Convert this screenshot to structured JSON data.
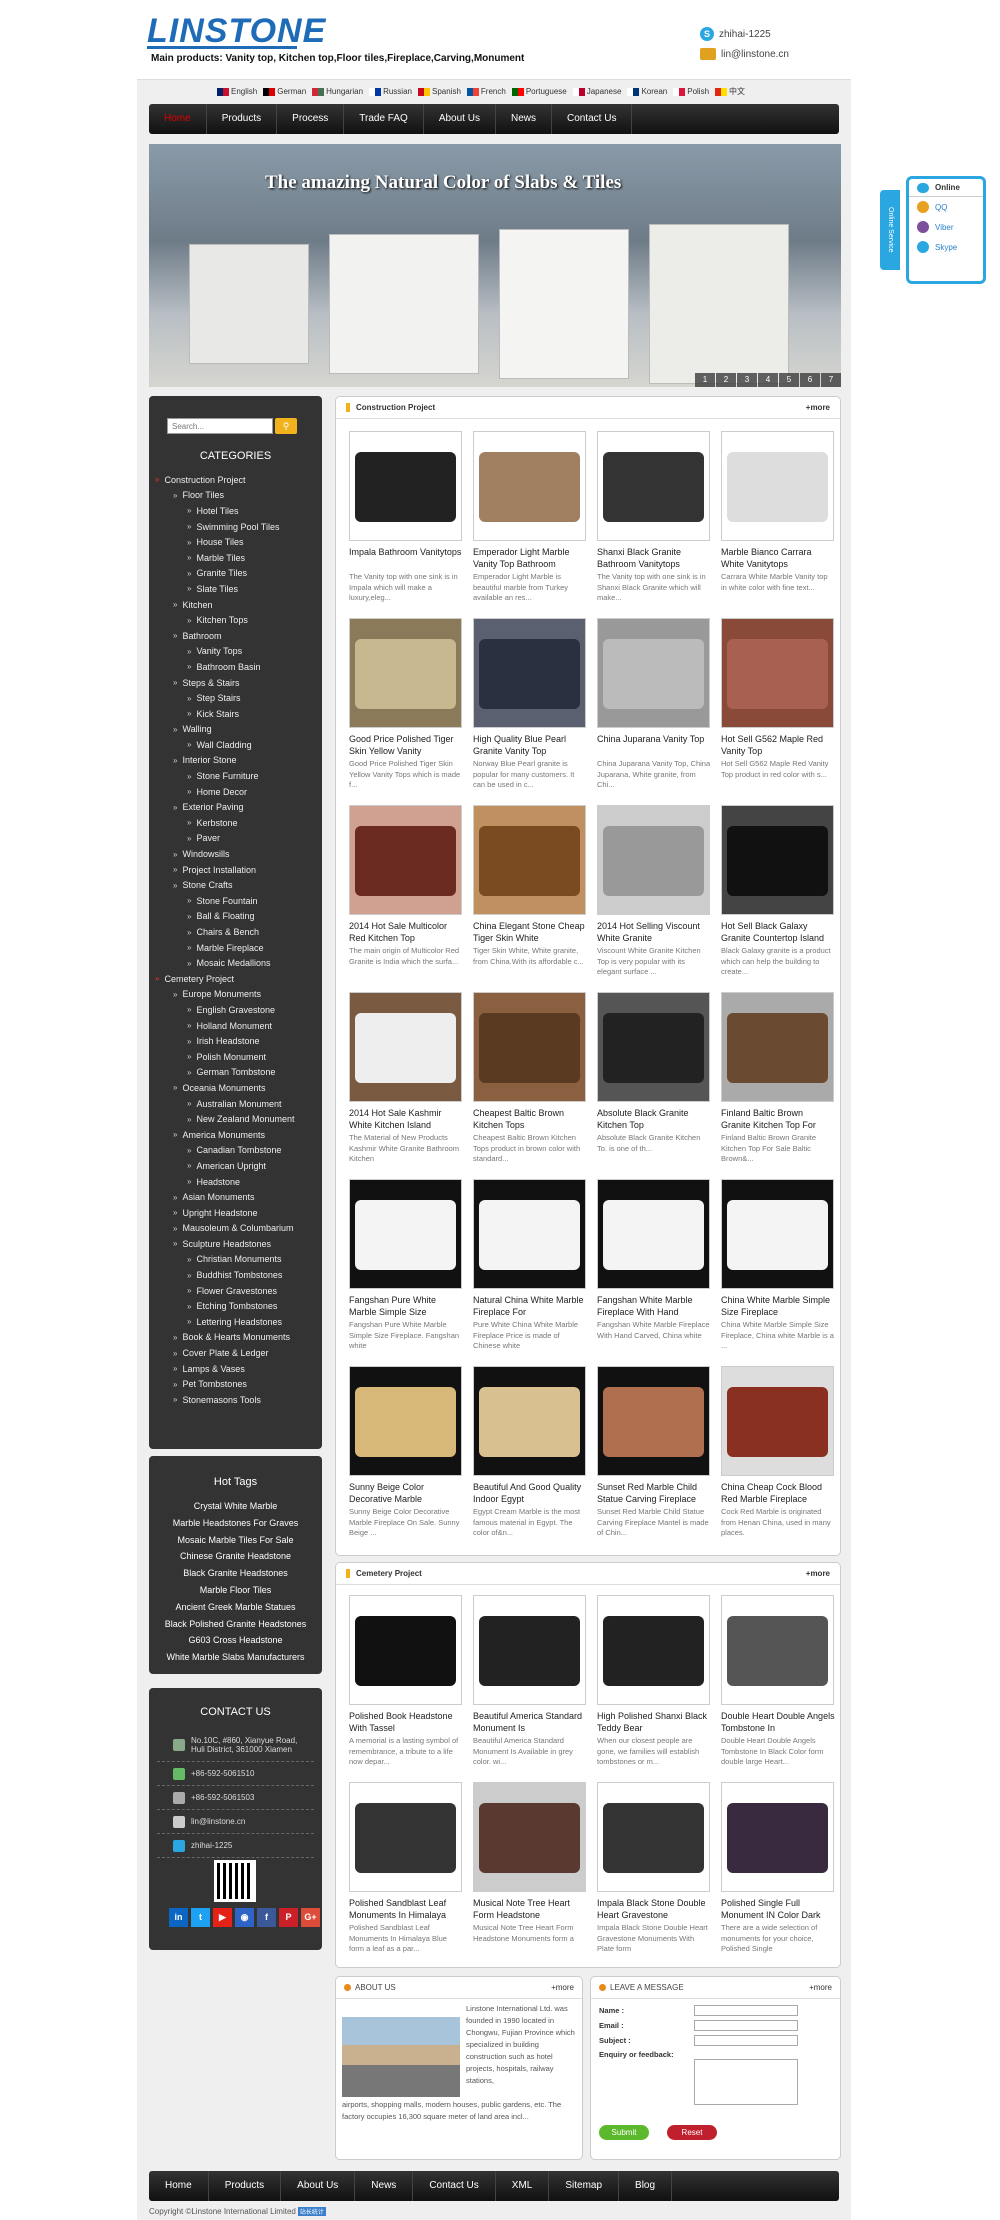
{
  "header": {
    "logo": "LINSTONE",
    "main_products": "Main products: Vanity top, Kitchen top,Floor tiles,Fireplace,Carving,Monument",
    "skype": "zhihai-1225",
    "email": "lin@linstone.cn"
  },
  "languages": [
    {
      "name": "English",
      "colors": [
        "#012169",
        "#c8102e"
      ]
    },
    {
      "name": "German",
      "colors": [
        "#000",
        "#dd0000"
      ]
    },
    {
      "name": "Hungarian",
      "colors": [
        "#ce2939",
        "#477050"
      ]
    },
    {
      "name": "Russian",
      "colors": [
        "#fff",
        "#0039a6"
      ]
    },
    {
      "name": "Spanish",
      "colors": [
        "#c60b1e",
        "#ffc400"
      ]
    },
    {
      "name": "French",
      "colors": [
        "#0055a4",
        "#ef4135"
      ]
    },
    {
      "name": "Portuguese",
      "colors": [
        "#006600",
        "#ff0000"
      ]
    },
    {
      "name": "Japanese",
      "colors": [
        "#fff",
        "#bc002d"
      ]
    },
    {
      "name": "Korean",
      "colors": [
        "#fff",
        "#003478"
      ]
    },
    {
      "name": "Polish",
      "colors": [
        "#fff",
        "#dc143c"
      ]
    },
    {
      "name": "中文",
      "colors": [
        "#de2910",
        "#ffde00"
      ]
    }
  ],
  "nav": [
    "Home",
    "Products",
    "Process",
    "Trade FAQ",
    "About Us",
    "News",
    "Contact Us"
  ],
  "banner": {
    "headline": "The amazing Natural Color of Slabs & Tiles",
    "pages": [
      "1",
      "2",
      "3",
      "4",
      "5",
      "6",
      "7"
    ]
  },
  "sidebar": {
    "search_placeholder": "Search...",
    "categories_title": "CATEGORIES",
    "categories": [
      {
        "label": "Construction Project",
        "level": 0
      },
      {
        "label": "Floor Tiles",
        "level": 1
      },
      {
        "label": "Hotel Tiles",
        "level": 2
      },
      {
        "label": "Swimming Pool Tiles",
        "level": 2
      },
      {
        "label": "House Tiles",
        "level": 2
      },
      {
        "label": "Marble Tiles",
        "level": 2
      },
      {
        "label": "Granite Tiles",
        "level": 2
      },
      {
        "label": "Slate Tiles",
        "level": 2
      },
      {
        "label": "Kitchen",
        "level": 1
      },
      {
        "label": "Kitchen Tops",
        "level": 2
      },
      {
        "label": "Bathroom",
        "level": 1
      },
      {
        "label": "Vanity Tops",
        "level": 2
      },
      {
        "label": "Bathroom Basin",
        "level": 2
      },
      {
        "label": "Steps & Stairs",
        "level": 1
      },
      {
        "label": "Step Stairs",
        "level": 2
      },
      {
        "label": "Kick Stairs",
        "level": 2
      },
      {
        "label": "Walling",
        "level": 1
      },
      {
        "label": "Wall Cladding",
        "level": 2
      },
      {
        "label": "Interior Stone",
        "level": 1
      },
      {
        "label": "Stone Furniture",
        "level": 2
      },
      {
        "label": "Home Decor",
        "level": 2
      },
      {
        "label": "Exterior Paving",
        "level": 1
      },
      {
        "label": "Kerbstone",
        "level": 2
      },
      {
        "label": "Paver",
        "level": 2
      },
      {
        "label": "Windowsills",
        "level": 1
      },
      {
        "label": "Project Installation",
        "level": 1
      },
      {
        "label": "Stone Crafts",
        "level": 1
      },
      {
        "label": "Stone Fountain",
        "level": 2
      },
      {
        "label": "Ball & Floating",
        "level": 2
      },
      {
        "label": "Chairs & Bench",
        "level": 2
      },
      {
        "label": "Marble Fireplace",
        "level": 2
      },
      {
        "label": "Mosaic Medallions",
        "level": 2
      },
      {
        "label": "Cemetery Project",
        "level": 0
      },
      {
        "label": "Europe Monuments",
        "level": 1
      },
      {
        "label": "English Gravestone",
        "level": 2
      },
      {
        "label": "Holland Monument",
        "level": 2
      },
      {
        "label": "Irish Headstone",
        "level": 2
      },
      {
        "label": "Polish Monument",
        "level": 2
      },
      {
        "label": "German Tombstone",
        "level": 2
      },
      {
        "label": "Oceania Monuments",
        "level": 1
      },
      {
        "label": "Australian Monument",
        "level": 2
      },
      {
        "label": "New Zealand Monument",
        "level": 2
      },
      {
        "label": "America Monuments",
        "level": 1
      },
      {
        "label": "Canadian Tombstone",
        "level": 2
      },
      {
        "label": "American Upright",
        "level": 2
      },
      {
        "label": "Headstone",
        "level": 2
      },
      {
        "label": "Asian Monuments",
        "level": 1
      },
      {
        "label": "Upright Headstone",
        "level": 1
      },
      {
        "label": "Mausoleum & Columbarium",
        "level": 1
      },
      {
        "label": "Sculpture Headstones",
        "level": 1
      },
      {
        "label": "Christian Monuments",
        "level": 2
      },
      {
        "label": "Buddhist Tombstones",
        "level": 2
      },
      {
        "label": "Flower Gravestones",
        "level": 2
      },
      {
        "label": "Etching Tombstones",
        "level": 2
      },
      {
        "label": "Lettering Headstones",
        "level": 2
      },
      {
        "label": "Book & Hearts Monuments",
        "level": 1
      },
      {
        "label": "Cover Plate & Ledger",
        "level": 1
      },
      {
        "label": "Lamps & Vases",
        "level": 1
      },
      {
        "label": "Pet Tombstones",
        "level": 1
      },
      {
        "label": "Stonemasons Tools",
        "level": 1
      }
    ],
    "hot_tags_title": "Hot Tags",
    "hot_tags": [
      "Crystal White Marble",
      "Marble Headstones For Graves",
      "Mosaic Marble Tiles For Sale",
      "Chinese Granite Headstone",
      "Black Granite Headstones",
      "Marble Floor Tiles",
      "Ancient Greek Marble Statues",
      "Black Polished Granite Headstones",
      "G603 Cross Headstone",
      "White Marble Slabs Manufacturers"
    ],
    "contact_title": "CONTACT US",
    "contact": {
      "address": "No.10C, #860, Xianyue Road, Huli District, 361000 Xiamen",
      "phone": "+86-592-5061510",
      "fax": "+86-592-5061503",
      "email": "lin@linstone.cn",
      "skype": "zhihai-1225"
    },
    "social": [
      {
        "label": "in",
        "color": "#0a66c2"
      },
      {
        "label": "t",
        "color": "#1da1f2"
      },
      {
        "label": "▶",
        "color": "#e62117"
      },
      {
        "label": "◉",
        "color": "#2d64c5"
      },
      {
        "label": "f",
        "color": "#3b5998"
      },
      {
        "label": "P",
        "color": "#cb2027"
      },
      {
        "label": "G+",
        "color": "#dd4b39"
      }
    ]
  },
  "construction": {
    "title": "Construction Project",
    "more": "+more",
    "items": [
      {
        "name": "Impala Bathroom Vanitytops",
        "desc": "The Vanity top with one sink is in Impala which will make a luxury,eleg...",
        "bg": "#fff",
        "fg": "#222"
      },
      {
        "name": "Emperador Light Marble Vanity Top Bathroom",
        "desc": "Emperador Light Marble is beautiful marble from Turkey available an res...",
        "bg": "#fff",
        "fg": "#a08060"
      },
      {
        "name": "Shanxi Black Granite Bathroom Vanitytops",
        "desc": "The Vanity top with one sink is in Shanxi Black Granite which will make...",
        "bg": "#fff",
        "fg": "#333"
      },
      {
        "name": "Marble Bianco Carrara White Vanitytops",
        "desc": "Carrara White Marble Vanity top in white color with fine text...",
        "bg": "#fff",
        "fg": "#ddd"
      },
      {
        "name": "Good Price Polished Tiger Skin Yellow Vanity",
        "desc": "Good Price Polished Tiger Skin Yellow Vanity Tops which is made f...",
        "bg": "#8a7a5a",
        "fg": "#c8b890"
      },
      {
        "name": "High Quality Blue Pearl Granite Vanity Top",
        "desc": "Norway Blue Pearl granite is popular for many customers. It can be used in c...",
        "bg": "#5a6070",
        "fg": "#2a3040"
      },
      {
        "name": "China Juparana Vanity Top",
        "desc": "China Juparana Vanity Top, China Juparana, White granite, from Chi...",
        "bg": "#999",
        "fg": "#bbb"
      },
      {
        "name": "Hot Sell G562 Maple Red Vanity Top",
        "desc": "Hot Sell G562 Maple Red Vanity Top product in red color with s...",
        "bg": "#8a4a3a",
        "fg": "#a86050"
      },
      {
        "name": "2014 Hot Sale Multicolor Red Kitchen Top",
        "desc": "The main origin of Multicolor Red Granite is India which the surfa...",
        "bg": "#d0a090",
        "fg": "#6a2a20"
      },
      {
        "name": "China Elegant Stone Cheap Tiger Skin White",
        "desc": "Tiger Skin White, White granite, from China.With its affordable c...",
        "bg": "#c09060",
        "fg": "#7a4a20"
      },
      {
        "name": "2014 Hot Selling Viscount White Granite",
        "desc": "Viscount White Granite Kitchen Top is very popular with its elegant surface ...",
        "bg": "#ccc",
        "fg": "#999"
      },
      {
        "name": "Hot Sell Black Galaxy Granite Countertop Island",
        "desc": "Black Galaxy granite is a product which can help the building to create...",
        "bg": "#444",
        "fg": "#111"
      },
      {
        "name": "2014 Hot Sale Kashmir White Kitchen Island",
        "desc": "The Material of New Products Kashmir White Granite Bathroom Kitchen",
        "bg": "#7a5a40",
        "fg": "#eee"
      },
      {
        "name": "Cheapest Baltic Brown Kitchen Tops",
        "desc": "Cheapest Baltic Brown Kitchen Tops product in brown color with standard...",
        "bg": "#8a6040",
        "fg": "#5a3a20"
      },
      {
        "name": "Absolute Black Granite Kitchen Top",
        "desc": "Absolute Black Granite Kitchen To. is one of th...",
        "bg": "#555",
        "fg": "#222"
      },
      {
        "name": "Finland Baltic Brown Granite Kitchen Top For",
        "desc": "Finland Baltic Brown Granite Kitchen Top For Sale Baltic Brown&...",
        "bg": "#aaa",
        "fg": "#6a4a30"
      },
      {
        "name": "Fangshan Pure White Marble Simple Size",
        "desc": "Fangshan Pure White Marble Simple Size Fireplace. Fangshan white",
        "bg": "#111",
        "fg": "#f4f4f4"
      },
      {
        "name": "Natural China White Marble Fireplace For",
        "desc": "Pure White China White Marble Fireplace Price is made of Chinese white",
        "bg": "#111",
        "fg": "#f4f4f4"
      },
      {
        "name": "Fangshan White Marble Fireplace With Hand",
        "desc": "Fangshan White Marble Fireplace With Hand Carved, China white",
        "bg": "#111",
        "fg": "#f4f4f4"
      },
      {
        "name": "China White Marble Simple Size Fireplace",
        "desc": "China White Marble Simple Size Fireplace, China white Marble is a ...",
        "bg": "#111",
        "fg": "#f4f4f4"
      },
      {
        "name": "Sunny Beige Color Decorative Marble",
        "desc": "Sunny Beige Color Decorative Marble Fireplace On Sale. Sunny Beige ...",
        "bg": "#111",
        "fg": "#d8b878"
      },
      {
        "name": "Beautiful And Good Quality Indoor Egypt",
        "desc": "Egypt Cream Marble is the most famous material in Egypt. The color of&n...",
        "bg": "#111",
        "fg": "#d8c090"
      },
      {
        "name": "Sunset Red Marble Child Statue Carving Fireplace",
        "desc": "Sunset Red Marble Child Statue Carving Fireplace Mantel is made of Chin...",
        "bg": "#111",
        "fg": "#b07050"
      },
      {
        "name": "China Cheap Cock Blood Red Marble Fireplace",
        "desc": "Cock Red Marble is originated from Henan China, used in many places.",
        "bg": "#ddd",
        "fg": "#8a3020"
      }
    ]
  },
  "cemetery": {
    "title": "Cemetery Project",
    "more": "+more",
    "items": [
      {
        "name": "Polished Book Headstone With Tassel",
        "desc": "A memorial is a lasting symbol of remembrance, a tribute to a life now depar...",
        "bg": "#fff",
        "fg": "#111"
      },
      {
        "name": "Beautiful America Standard Monument Is",
        "desc": "Beautiful America Standard Monument Is Available in grey color. wi...",
        "bg": "#fff",
        "fg": "#222"
      },
      {
        "name": "High Polished Shanxi Black Teddy Bear",
        "desc": "When our closest people are gone, we families will establish tombstones or m...",
        "bg": "#fff",
        "fg": "#222"
      },
      {
        "name": "Double Heart Double Angels Tombstone In",
        "desc": "Double Heart Double Angels Tombstone In Black Color form double large Heart...",
        "bg": "#fff",
        "fg": "#555"
      },
      {
        "name": "Polished Sandblast Leaf Monuments In Himalaya",
        "desc": "Polished Sandblast Leaf Monuments In Himalaya Blue form a leaf as a par...",
        "bg": "#fff",
        "fg": "#333"
      },
      {
        "name": "Musical Note Tree Heart Form Headstone",
        "desc": "Musical Note Tree Heart Form Headstone Monuments form a",
        "bg": "#ccc",
        "fg": "#5a3a30"
      },
      {
        "name": "Impala Black Stone Double Heart Gravestone",
        "desc": "Impala Black Stone Double Heart Gravestone Monuments With Plate form",
        "bg": "#fff",
        "fg": "#333"
      },
      {
        "name": "Polished Single Full Monument IN Color Dark",
        "desc": "There are a wide selection of monuments for your choice, Polished Single",
        "bg": "#fff",
        "fg": "#3a2a40"
      }
    ]
  },
  "about": {
    "title": "ABOUT US",
    "more": "+more",
    "text1": "Linstone International Ltd. was founded in 1990 located in Chongwu, Fujian Province which specialized in building construction such as hotel projects, hospitals, railway stations,",
    "text2": "airports, shopping malls, modern houses, public gardens, etc. The factory occupies 16,300 square meter of land area incl..."
  },
  "message": {
    "title": "LEAVE A MESSAGE",
    "more": "+more",
    "name_label": "Name :",
    "email_label": "Email :",
    "subject_label": "Subject :",
    "enquiry_label": "Enquiry or feedback:",
    "submit": "Submit",
    "reset": "Reset"
  },
  "footer_nav": [
    "Home",
    "Products",
    "About Us",
    "News",
    "Contact Us",
    "XML",
    "Sitemap",
    "Blog"
  ],
  "copyright": "Copyright ©Linstone International Limited",
  "copyright_badge": "站长统计",
  "online": {
    "tab": "Online Service",
    "title": "Online",
    "items": [
      {
        "label": "QQ",
        "color": "#e8a020"
      },
      {
        "label": "Viber",
        "color": "#7b519d"
      },
      {
        "label": "Skype",
        "color": "#2aa6e0"
      }
    ]
  }
}
